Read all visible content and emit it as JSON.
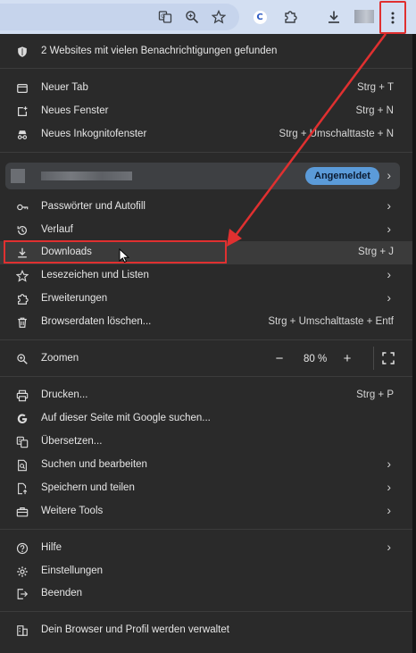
{
  "toolbar": {
    "icons": [
      "translate-icon",
      "zoom-icon",
      "bookmark-star-icon",
      "extension-c-icon",
      "puzzle-icon",
      "download-icon",
      "profile-avatar",
      "menu-kebab-icon"
    ],
    "ext_letter": "C"
  },
  "menu": {
    "notice": "2 Websites mit vielen Benachrichtigungen gefunden",
    "new_tab": {
      "label": "Neuer Tab",
      "shortcut": "Strg + T"
    },
    "new_window": {
      "label": "Neues Fenster",
      "shortcut": "Strg + N"
    },
    "incognito": {
      "label": "Neues Inkognitofenster",
      "shortcut": "Strg + Umschalttaste + N"
    },
    "profile": {
      "status": "Angemeldet"
    },
    "passwords": {
      "label": "Passwörter und Autofill"
    },
    "history": {
      "label": "Verlauf"
    },
    "downloads": {
      "label": "Downloads",
      "shortcut": "Strg + J"
    },
    "bookmarks": {
      "label": "Lesezeichen und Listen"
    },
    "extensions": {
      "label": "Erweiterungen"
    },
    "clear_data": {
      "label": "Browserdaten löschen...",
      "shortcut": "Strg + Umschalttaste + Entf"
    },
    "zoom": {
      "label": "Zoomen",
      "value": "80 %",
      "minus": "−",
      "plus": "+"
    },
    "print": {
      "label": "Drucken...",
      "shortcut": "Strg + P"
    },
    "google_search": {
      "label": "Auf dieser Seite mit Google suchen..."
    },
    "translate": {
      "label": "Übersetzen..."
    },
    "find_edit": {
      "label": "Suchen und bearbeiten"
    },
    "save_share": {
      "label": "Speichern und teilen"
    },
    "more_tools": {
      "label": "Weitere Tools"
    },
    "help": {
      "label": "Hilfe"
    },
    "settings": {
      "label": "Einstellungen"
    },
    "exit": {
      "label": "Beenden"
    },
    "managed": {
      "label": "Dein Browser und Profil werden verwaltet"
    },
    "chevron": "›"
  },
  "colors": {
    "annotation": "#e03030",
    "badge": "#5b9bd9",
    "menu_bg": "#2a2a2a"
  }
}
